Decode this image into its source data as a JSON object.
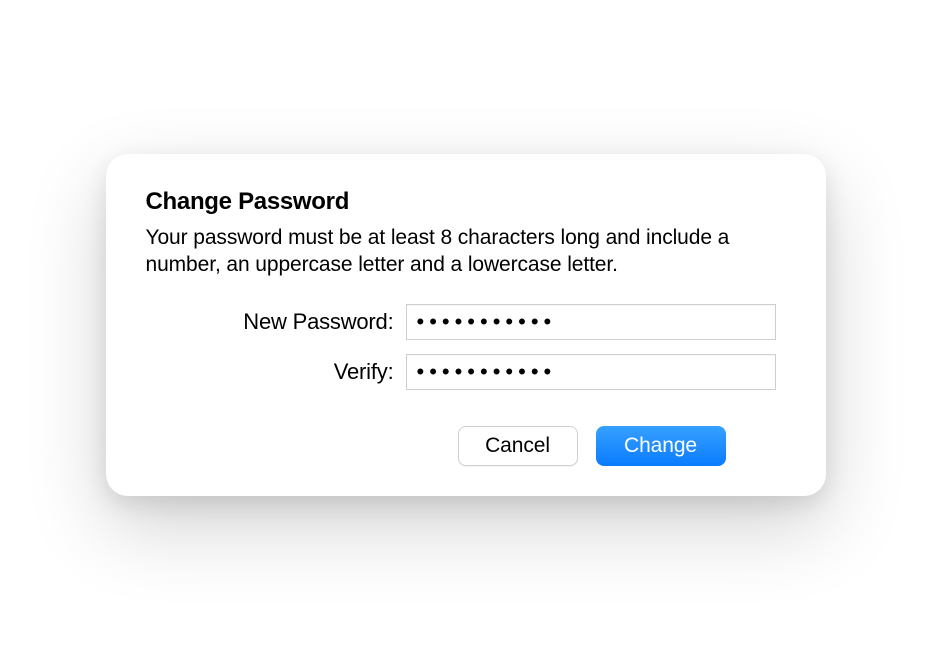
{
  "dialog": {
    "title": "Change Password",
    "description": "Your password must be at least 8 characters long and include a number, an uppercase letter and a lowercase letter.",
    "fields": {
      "new_password": {
        "label": "New Password:",
        "value": "•••••••••••"
      },
      "verify": {
        "label": "Verify:",
        "value": "•••••••••••"
      }
    },
    "buttons": {
      "cancel": "Cancel",
      "change": "Change"
    }
  }
}
